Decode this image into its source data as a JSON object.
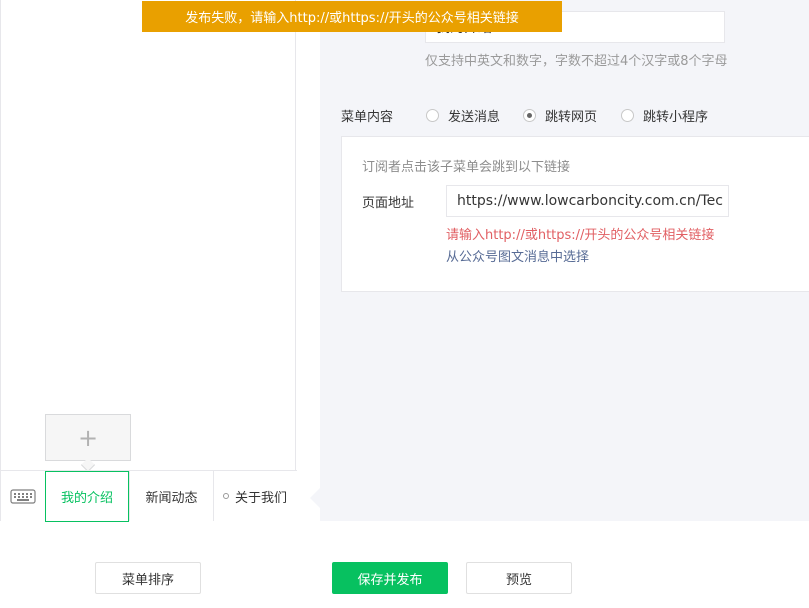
{
  "toast": {
    "message": "发布失败，请输入http://或https://开头的公众号相关链接"
  },
  "editor": {
    "name_value": "我的介绍",
    "name_hint": "仅支持中英文和数字，字数不超过4个汉字或8个字母",
    "content_label": "菜单内容",
    "radios": [
      {
        "label": "发送消息",
        "selected": false
      },
      {
        "label": "跳转网页",
        "selected": true
      },
      {
        "label": "跳转小程序",
        "selected": false
      }
    ],
    "link_desc": "订阅者点击该子菜单会跳到以下链接",
    "address_label": "页面地址",
    "url_value": "https://www.lowcarboncity.com.cn/Tec",
    "url_error": "请输入http://或https://开头的公众号相关链接",
    "pick_link": "从公众号图文消息中选择"
  },
  "phone": {
    "add_symbol": "+",
    "menu": [
      {
        "label": "我的介绍",
        "active": true
      },
      {
        "label": "新闻动态",
        "active": false
      },
      {
        "label": "关于我们",
        "active": false
      }
    ]
  },
  "buttons": {
    "sort": "菜单排序",
    "save_publish": "保存并发布",
    "preview": "预览"
  },
  "colors": {
    "accent": "#07c160",
    "toast": "#e9a000",
    "error": "#e15f63",
    "link": "#576b95"
  }
}
